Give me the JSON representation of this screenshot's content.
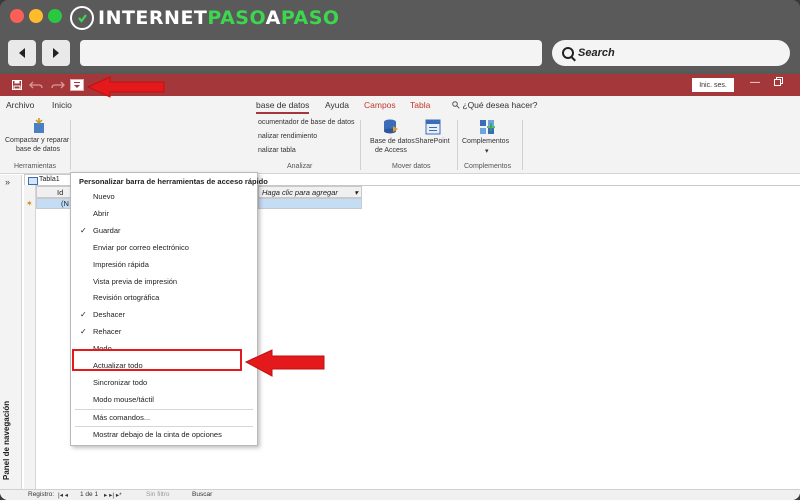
{
  "logo": {
    "text_white_1": "INTERNET",
    "text_green": "PASO",
    "text_white_2": "A",
    "text_green_2": "PASO"
  },
  "browser": {
    "back_icon": "left-arrow-icon",
    "forward_icon": "right-arrow-icon",
    "search_label": "Search"
  },
  "app": {
    "qat": {
      "save_icon": "save-icon",
      "undo_icon": "undo-icon",
      "redo_icon": "redo-icon",
      "customize_icon": "dropdown-icon"
    },
    "signin_label": "Inic. ses.",
    "tabs": [
      "Archivo",
      "Inicio",
      "base de datos",
      "Ayuda",
      "Campos",
      "Tabla",
      "¿Qué desea hacer?"
    ],
    "ribbon": {
      "compact_line1": "Compactar y reparar",
      "compact_line2": "base de datos",
      "group_herramientas": "Herramientas",
      "documenter": "ocumentador de base de datos",
      "analyze_perf": "nalizar rendimiento",
      "analyze_table": "nalizar tabla",
      "group_analizar": "Analizar",
      "access_db_line1": "Base de datos",
      "access_db_line2": "de Access",
      "sharepoint": "SharePoint",
      "group_mover": "Mover datos",
      "complementos": "Complementos",
      "complementos_arrow": "▾",
      "group_complementos": "Complementos"
    },
    "nav_pane": {
      "chevron": "»",
      "label": "Panel de navegación"
    },
    "table": {
      "tab_label": "Tabla1",
      "header_id": "Id",
      "header_add": "Haga clic para agregar",
      "header_add_arrow": "▾",
      "new_row_value": "(N"
    },
    "status": {
      "record_label": "Registro:",
      "position": "1 de 1",
      "filter": "Sin filtro",
      "search": "Buscar"
    }
  },
  "menu": {
    "title": "Personalizar barra de herramientas de acceso rápido",
    "items": [
      {
        "label": "Nuevo",
        "checked": ""
      },
      {
        "label": "Abrir",
        "checked": ""
      },
      {
        "label": "Guardar",
        "checked": "✓"
      },
      {
        "label": "Enviar por correo electrónico",
        "checked": ""
      },
      {
        "label": "Impresión rápida",
        "checked": ""
      },
      {
        "label": "Vista previa de impresión",
        "checked": ""
      },
      {
        "label": "Revisión ortográfica",
        "checked": ""
      },
      {
        "label": "Deshacer",
        "checked": "✓"
      },
      {
        "label": "Rehacer",
        "checked": "✓"
      },
      {
        "label": "Modo",
        "checked": ""
      },
      {
        "label": "Actualizar todo",
        "checked": ""
      },
      {
        "label": "Sincronizar todo",
        "checked": ""
      },
      {
        "label": "Modo mouse/táctil",
        "checked": ""
      }
    ],
    "more_commands": "Más comandos...",
    "show_below": "Mostrar debajo de la cinta de opciones"
  },
  "colors": {
    "access_red": "#a4373a",
    "annotation_red": "#e3191c",
    "selection_blue": "#c5dcf5"
  }
}
